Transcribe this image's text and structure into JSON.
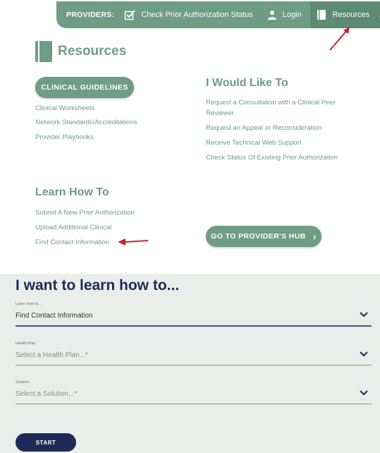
{
  "nav": {
    "providers_label": "PROVIDERS:",
    "check_status_label": "Check Prior Authorization Status",
    "login_label": "Login",
    "resources_label": "Resources",
    "chevron": "^"
  },
  "resources": {
    "title": "Resources",
    "clinical_guidelines_label": "CLINICAL GUIDELINES",
    "left_links": [
      "Clinical Worksheets",
      "Network Standards/Accreditations",
      "Provider Playbooks"
    ],
    "would_like_title": "I Would Like To",
    "right_links": [
      "Request a Consultation with a Clinical Peer",
      "Reviewer",
      "Request an Appeal or Reconsideration",
      "Receive Technical Web Support",
      "Check Status Of Existing Prior Authorization"
    ],
    "learn_title": "Learn How To",
    "learn_links": [
      "Submit A New Prior Authorization",
      "Upload Additional Clinical",
      "Find Contact Information"
    ],
    "hub_label": "GO TO PROVIDER'S HUB",
    "hub_chevron": "›"
  },
  "form": {
    "title": "I want to learn how to...",
    "learn_label": "Learn how to...",
    "learn_value": "Find Contact Information",
    "plan_label": "Health Plan",
    "plan_placeholder": "Select a Health Plan...*",
    "solution_label": "Solution",
    "solution_placeholder": "Select a Solution...*",
    "start_label": "START"
  },
  "colors": {
    "green": "#6e9c84",
    "navy": "#1f2b56",
    "red_arrow": "#c0262d",
    "form_bg": "#eaeeea"
  },
  "icons": {
    "check": "check-box-icon",
    "user": "user-icon",
    "book": "book-icon",
    "chevron": "chevron-down-icon"
  }
}
